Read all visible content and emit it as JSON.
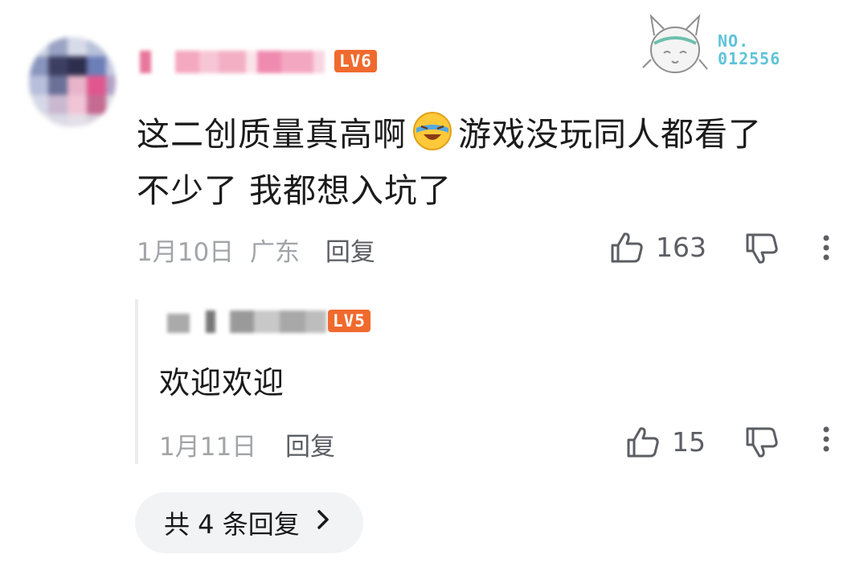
{
  "comment": {
    "user_level": "LV6",
    "text_part1": "这二创质量真高啊",
    "emoji_name": "laughing-crying-emoji",
    "text_part2": "游戏没玩同人都看了",
    "text_line2": "不少了 我都想入坑了",
    "date": "1月10日",
    "location": "广东",
    "reply_label": "回复",
    "like_count": "163"
  },
  "stamp": {
    "no_label": "NO.",
    "number": "012556"
  },
  "reply": {
    "user_level": "LV5",
    "text": "欢迎欢迎",
    "date": "1月11日",
    "reply_label": "回复",
    "like_count": "15"
  },
  "more_replies": {
    "label": "共 4 条回复"
  },
  "colors": {
    "level_badge": "#f06a2e",
    "meta_text": "#a2a4a8",
    "stamp_text": "#5fc3d8"
  }
}
